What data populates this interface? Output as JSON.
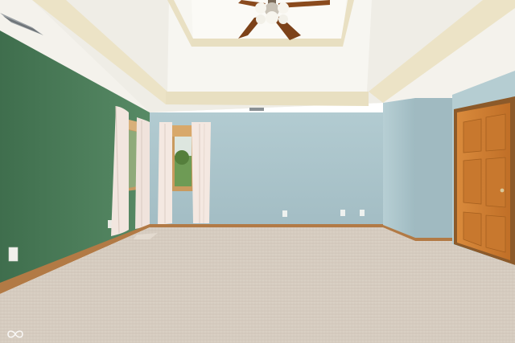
{
  "scene": {
    "kind": "photo",
    "subject": "empty-room"
  },
  "colors": {
    "ceiling": "#f4f2ec",
    "ceiling_trim": "#ece3c6",
    "green_wall": "#4a7a58",
    "blue_wall": "#a8c2c8",
    "carpet": "#d6ccc0",
    "door": "#cf7f31",
    "baseboard": "#b27a45",
    "curtain": "#f2e6df",
    "fan_blade": "#8a4a1d"
  },
  "icons": {
    "watermark": "infinity-icon"
  }
}
